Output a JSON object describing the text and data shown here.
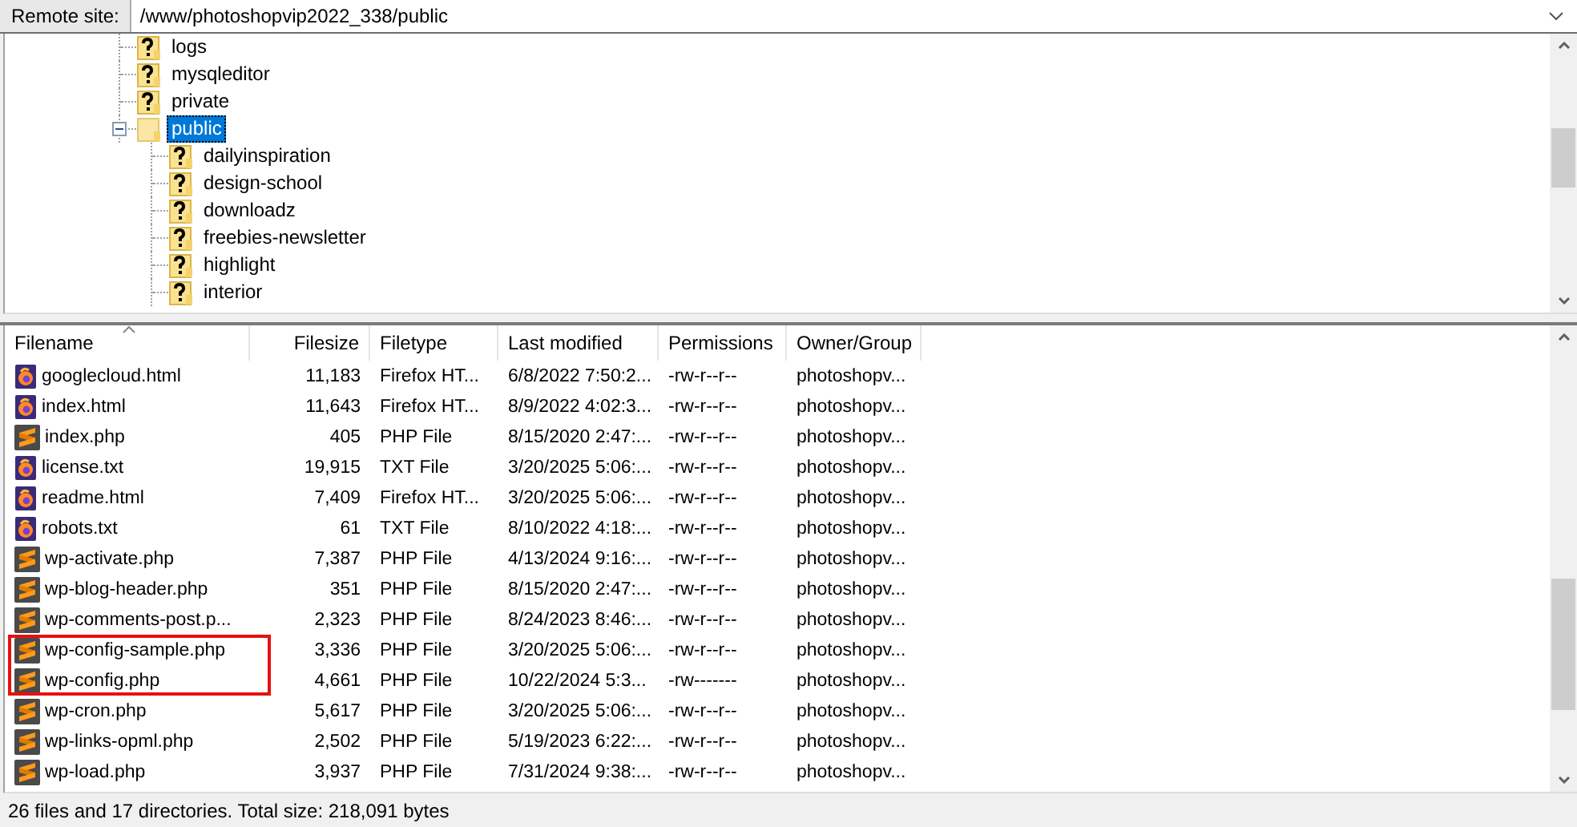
{
  "remote_site": {
    "label": "Remote site:",
    "path": "/www/photoshopvip2022_338/public"
  },
  "tree": [
    {
      "name": "logs",
      "kind": "unknown",
      "selected": false
    },
    {
      "name": "mysqleditor",
      "kind": "unknown",
      "selected": false
    },
    {
      "name": "private",
      "kind": "unknown",
      "selected": false
    },
    {
      "name": "public",
      "kind": "folder",
      "selected": true,
      "expanded": true,
      "children": [
        {
          "name": "dailyinspiration",
          "kind": "unknown",
          "selected": false
        },
        {
          "name": "design-school",
          "kind": "unknown",
          "selected": false
        },
        {
          "name": "downloadz",
          "kind": "unknown",
          "selected": false
        },
        {
          "name": "freebies-newsletter",
          "kind": "unknown",
          "selected": false
        },
        {
          "name": "highlight",
          "kind": "unknown",
          "selected": false
        },
        {
          "name": "interior",
          "kind": "unknown",
          "selected": false
        }
      ]
    }
  ],
  "table": {
    "columns": [
      "Filename",
      "Filesize",
      "Filetype",
      "Last modified",
      "Permissions",
      "Owner/Group"
    ],
    "rows": [
      {
        "kind": "html",
        "cells": [
          "googlecloud.html",
          "11,183",
          "Firefox HT...",
          "6/8/2022 7:50:2...",
          "-rw-r--r--",
          "photoshopv..."
        ],
        "highlighted": false
      },
      {
        "kind": "html",
        "cells": [
          "index.html",
          "11,643",
          "Firefox HT...",
          "8/9/2022 4:02:3...",
          "-rw-r--r--",
          "photoshopv..."
        ],
        "highlighted": false
      },
      {
        "kind": "php",
        "cells": [
          "index.php",
          "405",
          "PHP File",
          "8/15/2020 2:47:...",
          "-rw-r--r--",
          "photoshopv..."
        ],
        "highlighted": false
      },
      {
        "kind": "html",
        "cells": [
          "license.txt",
          "19,915",
          "TXT File",
          "3/20/2025 5:06:...",
          "-rw-r--r--",
          "photoshopv..."
        ],
        "highlighted": false
      },
      {
        "kind": "html",
        "cells": [
          "readme.html",
          "7,409",
          "Firefox HT...",
          "3/20/2025 5:06:...",
          "-rw-r--r--",
          "photoshopv..."
        ],
        "highlighted": false
      },
      {
        "kind": "html",
        "cells": [
          "robots.txt",
          "61",
          "TXT File",
          "8/10/2022 4:18:...",
          "-rw-r--r--",
          "photoshopv..."
        ],
        "highlighted": false
      },
      {
        "kind": "php",
        "cells": [
          "wp-activate.php",
          "7,387",
          "PHP File",
          "4/13/2024 9:16:...",
          "-rw-r--r--",
          "photoshopv..."
        ],
        "highlighted": false
      },
      {
        "kind": "php",
        "cells": [
          "wp-blog-header.php",
          "351",
          "PHP File",
          "8/15/2020 2:47:...",
          "-rw-r--r--",
          "photoshopv..."
        ],
        "highlighted": false
      },
      {
        "kind": "php",
        "cells": [
          "wp-comments-post.p...",
          "2,323",
          "PHP File",
          "8/24/2023 8:46:...",
          "-rw-r--r--",
          "photoshopv..."
        ],
        "highlighted": false
      },
      {
        "kind": "php",
        "cells": [
          "wp-config-sample.php",
          "3,336",
          "PHP File",
          "3/20/2025 5:06:...",
          "-rw-r--r--",
          "photoshopv..."
        ],
        "highlighted": true
      },
      {
        "kind": "php",
        "cells": [
          "wp-config.php",
          "4,661",
          "PHP File",
          "10/22/2024 5:3...",
          "-rw-------",
          "photoshopv..."
        ],
        "highlighted": true
      },
      {
        "kind": "php",
        "cells": [
          "wp-cron.php",
          "5,617",
          "PHP File",
          "3/20/2025 5:06:...",
          "-rw-r--r--",
          "photoshopv..."
        ],
        "highlighted": false
      },
      {
        "kind": "php",
        "cells": [
          "wp-links-opml.php",
          "2,502",
          "PHP File",
          "5/19/2023 6:22:...",
          "-rw-r--r--",
          "photoshopv..."
        ],
        "highlighted": false
      },
      {
        "kind": "php",
        "cells": [
          "wp-load.php",
          "3,937",
          "PHP File",
          "7/31/2024 9:38:...",
          "-rw-r--r--",
          "photoshopv..."
        ],
        "highlighted": false
      }
    ]
  },
  "status_bar": "26 files and 17 directories. Total size: 218,091 bytes"
}
